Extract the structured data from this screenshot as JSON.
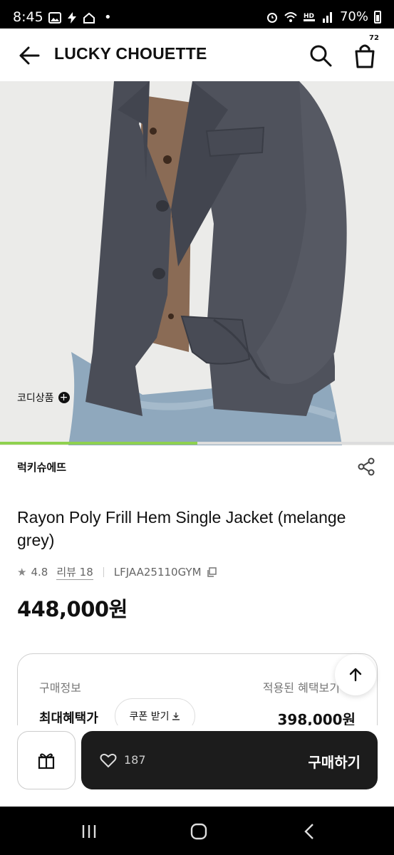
{
  "status_bar": {
    "time": "8:45",
    "battery": "70%",
    "dot": "•",
    "icons": [
      "image-icon",
      "bolt-icon",
      "home-icon",
      "alarm-icon",
      "wifi-icon",
      "hd-icon",
      "signal-icon",
      "battery-icon"
    ]
  },
  "header": {
    "brand": "LUCKY CHOUETTE",
    "cart_count": "72",
    "icons": [
      "back-arrow-icon",
      "search-icon",
      "shopping-bag-icon"
    ]
  },
  "hero": {
    "coordi_label": "코디상품",
    "progress": 0.5
  },
  "product": {
    "seller": "럭키슈에뜨",
    "title": "Rayon Poly Frill Hem Single Jacket (melange grey)",
    "rating": "4.8",
    "review_label": "리뷰 18",
    "sku": "LFJAA25110GYM",
    "price": "448,000원"
  },
  "purchase_info": {
    "label": "구매정보",
    "applied_label": "적용된 혜택보기",
    "max_benefit_label": "최대혜택가",
    "coupon_label": "쿠폰 받기",
    "max_benefit_price": "398,000원"
  },
  "action_bar": {
    "like_count": "187",
    "buy_label": "구매하기"
  },
  "colors": {
    "accent_progress": "#8fd14f",
    "buy_button": "#1c1c1c"
  }
}
